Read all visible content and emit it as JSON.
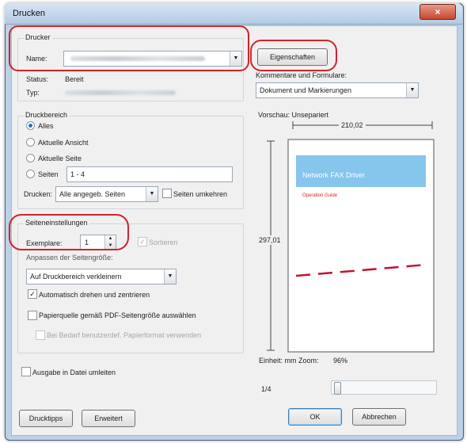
{
  "window": {
    "title": "Drucken",
    "close_glyph": "×"
  },
  "printer": {
    "group_title": "Drucker",
    "name_label": "Name:",
    "properties_button": "Eigenschaften",
    "status_label": "Status:",
    "status_value": "Bereit",
    "type_label": "Typ:"
  },
  "comments": {
    "label": "Kommentare und Formulare:",
    "value": "Dokument und Markierungen"
  },
  "print_range": {
    "group_title": "Druckbereich",
    "options": [
      "Alles",
      "Aktuelle Ansicht",
      "Aktuelle Seite",
      "Seiten"
    ],
    "selected_index": 0,
    "pages_value": "1 - 4",
    "print_label": "Drucken:",
    "print_value": "Alle angegeb. Seiten",
    "reverse_label": "Seiten umkehren"
  },
  "page_handling": {
    "group_title": "Seiteneinstellungen",
    "copies_label": "Exemplare:",
    "copies_value": "1",
    "collate_label": "Sortieren",
    "scaling_label": "Anpassen der Seitengröße:",
    "scaling_value": "Auf Druckbereich verkleinern",
    "auto_rotate_label": "Automatisch drehen und zentrieren",
    "auto_rotate_checked": true,
    "paper_source_label": "Papierquelle gemäß PDF-Seitengröße auswählen",
    "paper_source_checked": false,
    "custom_paper_label": "Bei Bedarf benutzerdef. Papierformat verwenden"
  },
  "output_to_file_label": "Ausgabe in Datei umleiten",
  "preview": {
    "label": "Vorschau: Unsepariert",
    "width_value": "210,02",
    "height_value": "297,01",
    "page_banner": "Network FAX Driver",
    "page_subtext": "Operation Guide",
    "units_label": "Einheit: mm Zoom:",
    "zoom_value": "96%",
    "page_indicator": "1/4"
  },
  "buttons": {
    "print_tips": "Drucktipps",
    "advanced": "Erweitert",
    "ok": "OK",
    "cancel": "Abbrechen"
  },
  "colors": {
    "highlight": "#d2222b",
    "banner": "#86c5ec",
    "accent": "#2d6fb8"
  },
  "icons": {
    "dropdown": "chevron-down-icon",
    "radio": "radio-icon",
    "check": "checkbox-icon",
    "spin": "spinner-icon"
  }
}
